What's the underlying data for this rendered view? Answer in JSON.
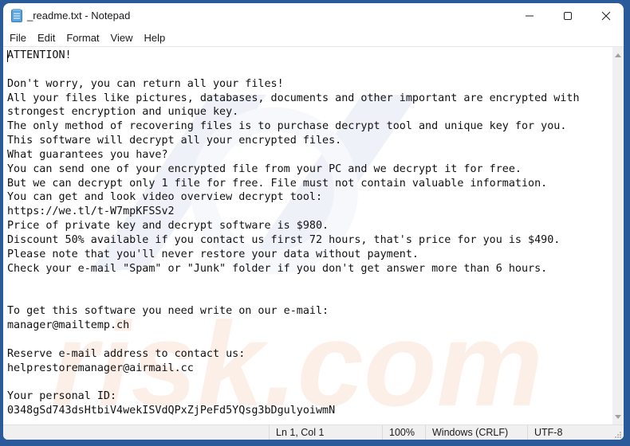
{
  "window": {
    "title": "_readme.txt - Notepad",
    "app_icon": "notepad-icon",
    "controls": [
      "minimize-icon",
      "maximize-icon",
      "close-icon"
    ]
  },
  "menu": {
    "items": [
      {
        "label": "File"
      },
      {
        "label": "Edit"
      },
      {
        "label": "Format"
      },
      {
        "label": "View"
      },
      {
        "label": "Help"
      }
    ]
  },
  "document": {
    "lines": [
      "ATTENTION!",
      "",
      "Don't worry, you can return all your files!",
      "All your files like pictures, databases, documents and other important are encrypted with",
      "strongest encryption and unique key.",
      "The only method of recovering files is to purchase decrypt tool and unique key for you.",
      "This software will decrypt all your encrypted files.",
      "What guarantees you have?",
      "You can send one of your encrypted file from your PC and we decrypt it for free.",
      "But we can decrypt only 1 file for free. File must not contain valuable information.",
      "You can get and look video overview decrypt tool:",
      "https://we.tl/t-W7mpKFSSv2",
      "Price of private key and decrypt software is $980.",
      "Discount 50% available if you contact us first 72 hours, that's price for you is $490.",
      "Please note that you'll never restore your data without payment.",
      "Check your e-mail \"Spam\" or \"Junk\" folder if you don't get answer more than 6 hours.",
      "",
      "",
      "To get this software you need write on our e-mail:",
      "manager@mailtemp.ch",
      "",
      "Reserve e-mail address to contact us:",
      "helprestoremanager@airmail.cc",
      "",
      "Your personal ID:",
      "0348gSd743dsHtbiV4wekISVdQPxZjPeFd5YQsg3bDgulyoiwmN"
    ]
  },
  "statusbar": {
    "position": "Ln 1, Col 1",
    "zoom": "100%",
    "line_endings": "Windows (CRLF)",
    "encoding": "UTF-8"
  },
  "colors": {
    "desktop": "#2a5a9a",
    "watermark": "#e8eef6",
    "watermark_accent": "#fbe3d6"
  }
}
